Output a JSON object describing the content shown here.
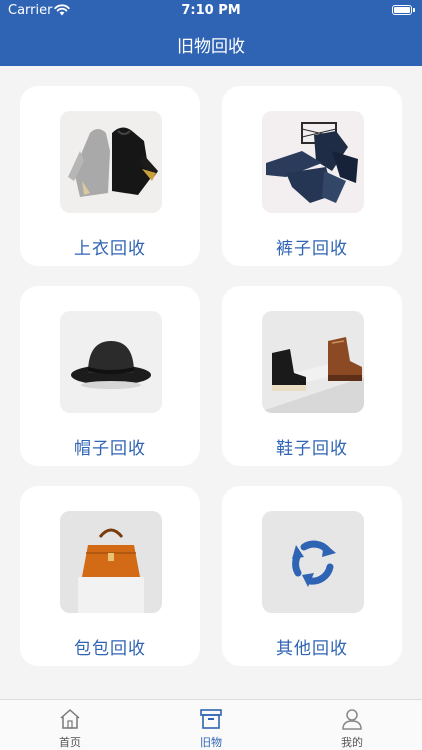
{
  "status_bar": {
    "carrier": "Carrier",
    "time": "7:10 PM"
  },
  "header": {
    "title": "旧物回收"
  },
  "categories": [
    {
      "label": "上衣回收",
      "icon": "jacket-image"
    },
    {
      "label": "裤子回收",
      "icon": "pants-image"
    },
    {
      "label": "帽子回收",
      "icon": "hat-image"
    },
    {
      "label": "鞋子回收",
      "icon": "boots-image"
    },
    {
      "label": "包包回收",
      "icon": "handbag-image"
    },
    {
      "label": "其他回收",
      "icon": "recycle-icon"
    }
  ],
  "tabbar": {
    "items": [
      {
        "label": "首页",
        "icon": "home-icon",
        "active": false
      },
      {
        "label": "旧物",
        "icon": "box-icon",
        "active": true
      },
      {
        "label": "我的",
        "icon": "profile-icon",
        "active": false
      }
    ]
  },
  "colors": {
    "accent": "#2f64b4",
    "background": "#f4f4f4",
    "card": "#ffffff"
  }
}
